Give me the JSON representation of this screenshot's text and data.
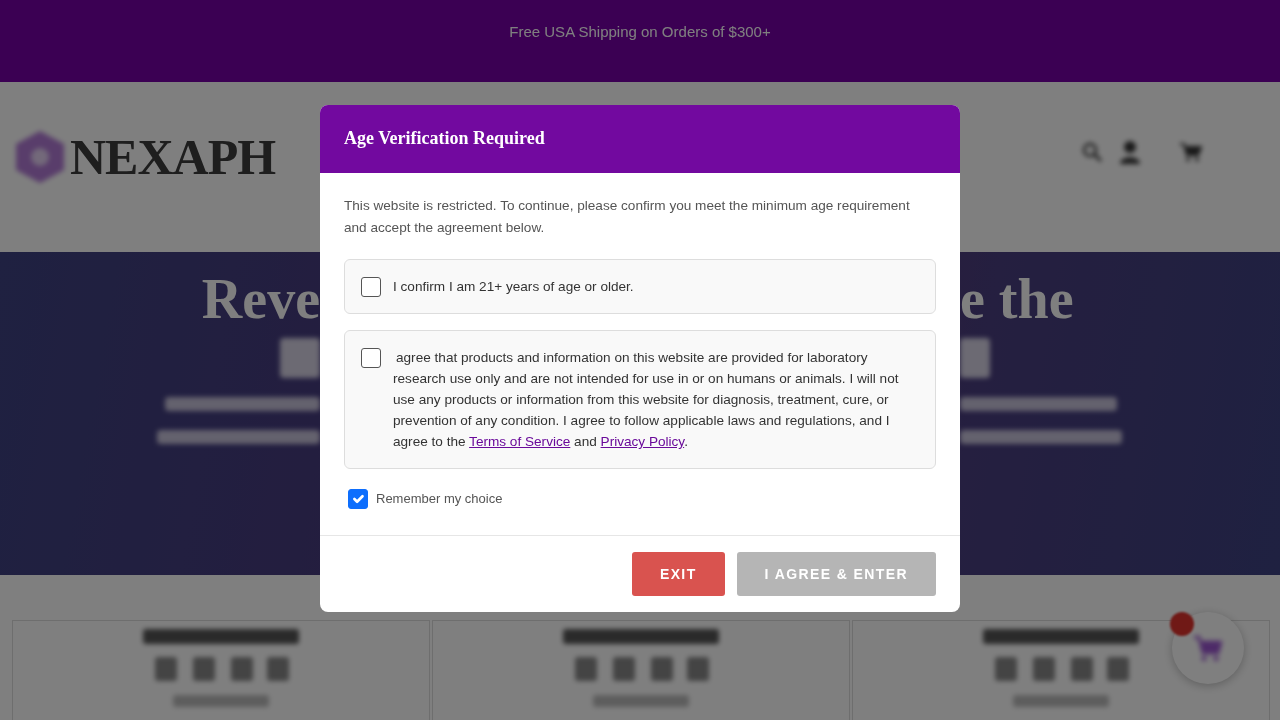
{
  "announcement": {
    "text": "Free USA Shipping on Orders of $300+"
  },
  "header": {
    "logo_text": "NEXAPH"
  },
  "hero": {
    "heading_left": "Reve",
    "heading_right": "e the"
  },
  "modal": {
    "title": "Age Verification Required",
    "intro": "This website is restricted. To continue, please confirm you meet the minimum age requirement and accept the agreement below.",
    "consents": [
      {
        "checked": false,
        "segments": [
          {
            "kind": "text",
            "text": "I confirm I am 21+ years of age or older."
          }
        ]
      },
      {
        "checked": false,
        "segments": [
          {
            "kind": "text",
            "text": "agree that products and information on this website are provided for laboratory research use only and are not intended for use in or on humans or animals. I will not use any products or information from this website for diagnosis, treatment, cure, or prevention of any condition. I agree to follow applicable laws and regulations, and I agree to the "
          },
          {
            "kind": "link",
            "text": "Terms of Service"
          },
          {
            "kind": "text",
            "text": " and "
          },
          {
            "kind": "link",
            "text": "Privacy Policy"
          },
          {
            "kind": "text",
            "text": "."
          }
        ]
      }
    ],
    "remember": {
      "label": "Remember my choice",
      "checked": true
    },
    "buttons": [
      {
        "kind": "exit",
        "label": "EXIT",
        "disabled": false
      },
      {
        "kind": "agree",
        "label": "I AGREE & ENTER",
        "disabled": true
      }
    ]
  }
}
